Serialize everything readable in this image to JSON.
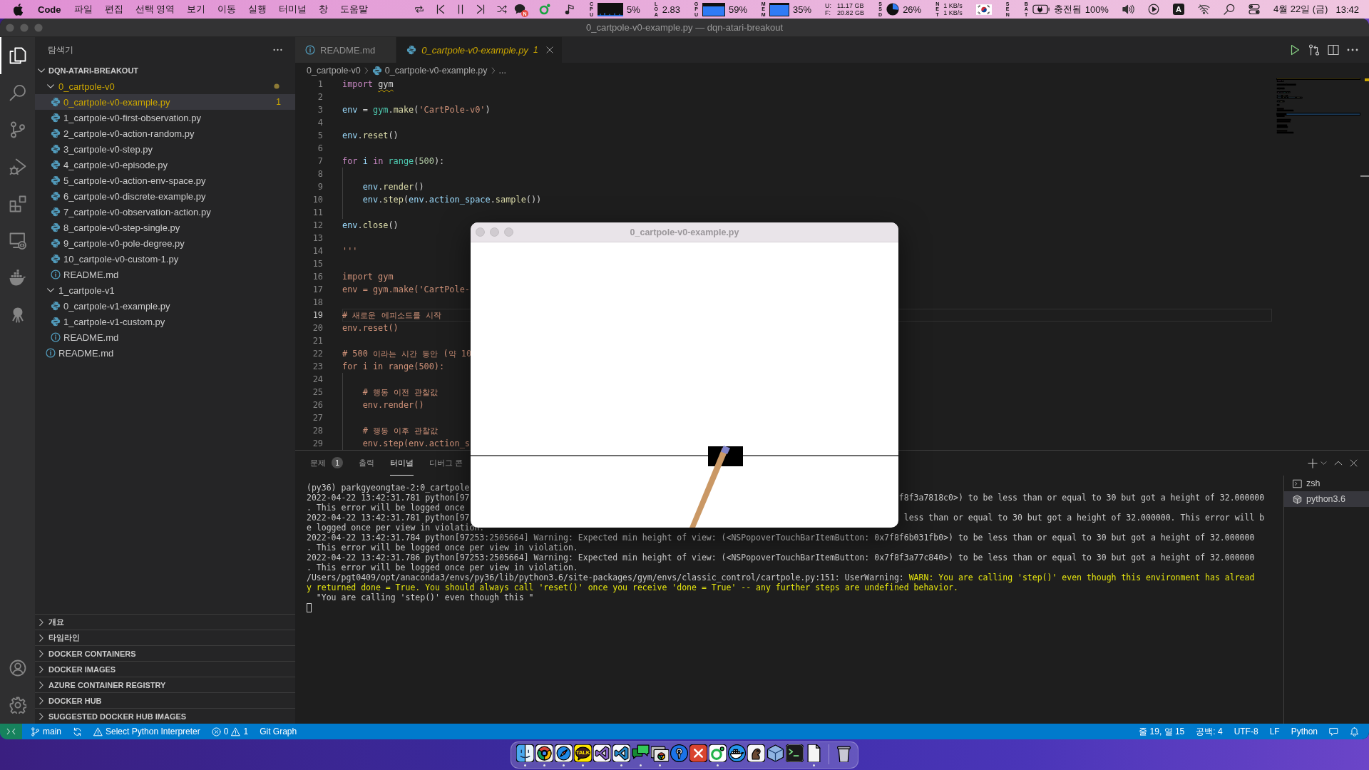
{
  "menu_bar": {
    "app_name": "Code",
    "menus": [
      "파일",
      "편집",
      "선택 영역",
      "보기",
      "이동",
      "실행",
      "터미널",
      "창",
      "도움말"
    ],
    "media_controls": [
      {
        "kind": "repeat"
      },
      {
        "kind": "previous"
      },
      {
        "kind": "pause"
      },
      {
        "kind": "next"
      },
      {
        "kind": "shuffle"
      }
    ],
    "status_items": [
      {
        "kind": "chat",
        "badge": "N"
      },
      {
        "kind": "ring"
      },
      {
        "kind": "note"
      },
      {
        "kind": "cpu",
        "label": "CPU",
        "value": "5%"
      },
      {
        "kind": "load",
        "label": "LOA",
        "value": "2.83"
      },
      {
        "kind": "gpu",
        "label": "GPU",
        "value": "59%"
      },
      {
        "kind": "mem",
        "label": "MEM",
        "value": "35%"
      },
      {
        "kind": "disk",
        "rows": [
          {
            "label": "U:",
            "value": "11.17 GB"
          },
          {
            "label": "F:",
            "value": "20.82 GB"
          }
        ]
      },
      {
        "kind": "ssd",
        "label": "SSD",
        "value": "26%"
      },
      {
        "kind": "net",
        "label": "NET",
        "rates": [
          "1 KB/s",
          "1 KB/s"
        ]
      },
      {
        "kind": "flag"
      },
      {
        "kind": "sensor",
        "label": "SEN"
      },
      {
        "kind": "battery",
        "label": "BAT",
        "state": "충전됨",
        "value": "100%"
      },
      {
        "kind": "volume"
      },
      {
        "kind": "play"
      },
      {
        "kind": "input",
        "label": "A"
      },
      {
        "kind": "wifi"
      },
      {
        "kind": "search"
      },
      {
        "kind": "control"
      },
      {
        "kind": "clock",
        "date": "4월 22일 (금)",
        "time": "13:42"
      }
    ]
  },
  "window": {
    "title": "0_cartpole-v0-example.py — dqn-atari-breakout"
  },
  "activity_bar": {
    "items": [
      {
        "kind": "explorer",
        "selected": true
      },
      {
        "kind": "search",
        "selected": false
      },
      {
        "kind": "scm",
        "selected": false
      },
      {
        "kind": "debug",
        "selected": false
      },
      {
        "kind": "extensions",
        "selected": false
      },
      {
        "kind": "remote",
        "selected": false
      },
      {
        "kind": "docker",
        "selected": false
      },
      {
        "kind": "octopus",
        "selected": false
      }
    ],
    "bottom": [
      {
        "kind": "account"
      },
      {
        "kind": "settings"
      }
    ]
  },
  "sidebar": {
    "title": "탐색기",
    "root": {
      "label": "DQN-ATARI-BREAKOUT",
      "expanded": true
    },
    "tree": [
      {
        "kind": "folder",
        "label": "0_cartpole-v0",
        "expanded": true,
        "selected": false,
        "warning": true,
        "children": [
          {
            "kind": "python",
            "label": "0_cartpole-v0-example.py",
            "badge": "1",
            "selected": true,
            "warning": true
          },
          {
            "kind": "python",
            "label": "1_cartpole-v0-first-observation.py",
            "selected": false,
            "warning": false
          },
          {
            "kind": "python",
            "label": "2_cartpole-v0-action-random.py",
            "selected": false,
            "warning": false
          },
          {
            "kind": "python",
            "label": "3_cartpole-v0-step.py",
            "selected": false,
            "warning": false
          },
          {
            "kind": "python",
            "label": "4_cartpole-v0-episode.py",
            "selected": false,
            "warning": false
          },
          {
            "kind": "python",
            "label": "5_cartpole-v0-action-env-space.py",
            "selected": false,
            "warning": false
          },
          {
            "kind": "python",
            "label": "6_cartpole-v0-discrete-example.py",
            "selected": false,
            "warning": false
          },
          {
            "kind": "python",
            "label": "7_cartpole-v0-observation-action.py",
            "selected": false,
            "warning": false
          },
          {
            "kind": "python",
            "label": "8_cartpole-v0-step-single.py",
            "selected": false,
            "warning": false
          },
          {
            "kind": "python",
            "label": "9_cartpole-v0-pole-degree.py",
            "selected": false,
            "warning": false
          },
          {
            "kind": "python",
            "label": "10_cartpole-v0-custom-1.py",
            "selected": false,
            "warning": false
          },
          {
            "kind": "markdown",
            "label": "README.md",
            "selected": false,
            "warning": false
          }
        ]
      },
      {
        "kind": "folder",
        "label": "1_cartpole-v1",
        "expanded": true,
        "selected": false,
        "warning": false,
        "children": [
          {
            "kind": "python",
            "label": "0_cartpole-v1-example.py",
            "selected": false,
            "warning": false
          },
          {
            "kind": "python",
            "label": "1_cartpole-v1-custom.py",
            "selected": false,
            "warning": false
          },
          {
            "kind": "markdown",
            "label": "README.md",
            "selected": false,
            "warning": false
          }
        ]
      },
      {
        "kind": "markdown",
        "label": "README.md",
        "selected": false,
        "warning": false
      }
    ],
    "sections": [
      {
        "label": "개요",
        "expanded": false
      },
      {
        "label": "타임라인",
        "expanded": false
      },
      {
        "label": "DOCKER CONTAINERS",
        "expanded": false
      },
      {
        "label": "DOCKER IMAGES",
        "expanded": false
      },
      {
        "label": "AZURE CONTAINER REGISTRY",
        "expanded": false
      },
      {
        "label": "DOCKER HUB",
        "expanded": false
      },
      {
        "label": "SUGGESTED DOCKER HUB IMAGES",
        "expanded": false
      }
    ]
  },
  "editor": {
    "tabs": [
      {
        "kind": "markdown",
        "label": "README.md",
        "selected": false,
        "preview": false,
        "warning": false
      },
      {
        "kind": "python",
        "label": "0_cartpole-v0-example.py",
        "badge": "1",
        "selected": true,
        "preview": true,
        "warning": true
      }
    ],
    "actions": [
      {
        "kind": "run"
      },
      {
        "kind": "compare"
      },
      {
        "kind": "split"
      },
      {
        "kind": "more"
      }
    ],
    "breadcrumb": [
      {
        "kind": "folder",
        "label": "0_cartpole-v0"
      },
      {
        "kind": "python",
        "label": "0_cartpole-v0-example.py"
      },
      {
        "kind": "symbol",
        "label": "..."
      }
    ],
    "lines": [
      {
        "number": "1",
        "current": false,
        "tokens": [
          {
            "kind": "keyword",
            "text": "import "
          },
          {
            "kind": "unresolved",
            "text": "gym"
          }
        ]
      },
      {
        "number": "2",
        "current": false
      },
      {
        "number": "3",
        "current": false,
        "tokens": [
          {
            "kind": "variable",
            "text": "env"
          },
          {
            "kind": "plain",
            "text": " = "
          },
          {
            "kind": "module",
            "text": "gym"
          },
          {
            "kind": "plain",
            "text": "."
          },
          {
            "kind": "function",
            "text": "make"
          },
          {
            "kind": "plain",
            "text": "("
          },
          {
            "kind": "string",
            "text": "'CartPole-v0'"
          },
          {
            "kind": "plain",
            "text": ")"
          }
        ]
      },
      {
        "number": "4",
        "current": false
      },
      {
        "number": "5",
        "current": false,
        "tokens": [
          {
            "kind": "variable",
            "text": "env"
          },
          {
            "kind": "plain",
            "text": "."
          },
          {
            "kind": "function",
            "text": "reset"
          },
          {
            "kind": "plain",
            "text": "()"
          }
        ]
      },
      {
        "number": "6",
        "current": false
      },
      {
        "number": "7",
        "current": false,
        "tokens": [
          {
            "kind": "keyword",
            "text": "for "
          },
          {
            "kind": "variable",
            "text": "i "
          },
          {
            "kind": "keyword",
            "text": "in "
          },
          {
            "kind": "builtin",
            "text": "range"
          },
          {
            "kind": "plain",
            "text": "("
          },
          {
            "kind": "number",
            "text": "500"
          },
          {
            "kind": "plain",
            "text": "):"
          }
        ]
      },
      {
        "number": "8",
        "current": false
      },
      {
        "number": "9",
        "current": false,
        "tokens": [
          {
            "kind": "variable",
            "text": "    env"
          },
          {
            "kind": "plain",
            "text": "."
          },
          {
            "kind": "function",
            "text": "render"
          },
          {
            "kind": "plain",
            "text": "()"
          }
        ]
      },
      {
        "number": "10",
        "current": false,
        "tokens": [
          {
            "kind": "variable",
            "text": "    env"
          },
          {
            "kind": "plain",
            "text": "."
          },
          {
            "kind": "function",
            "text": "step"
          },
          {
            "kind": "plain",
            "text": "("
          },
          {
            "kind": "variable",
            "text": "env"
          },
          {
            "kind": "plain",
            "text": "."
          },
          {
            "kind": "variable",
            "text": "action_space"
          },
          {
            "kind": "plain",
            "text": "."
          },
          {
            "kind": "function",
            "text": "sample"
          },
          {
            "kind": "plain",
            "text": "())"
          }
        ]
      },
      {
        "number": "11",
        "current": false
      },
      {
        "number": "12",
        "current": false,
        "tokens": [
          {
            "kind": "variable",
            "text": "env"
          },
          {
            "kind": "plain",
            "text": "."
          },
          {
            "kind": "function",
            "text": "close"
          },
          {
            "kind": "plain",
            "text": "()"
          }
        ]
      },
      {
        "number": "13",
        "current": false
      },
      {
        "number": "14",
        "current": false,
        "tokens": [
          {
            "kind": "string",
            "text": "'''"
          }
        ]
      },
      {
        "number": "15",
        "current": false
      },
      {
        "number": "16",
        "current": false,
        "tokens": [
          {
            "kind": "string",
            "text": "import gym"
          }
        ]
      },
      {
        "number": "17",
        "current": false,
        "tokens": [
          {
            "kind": "string",
            "text": "env = gym.make('CartPole-"
          }
        ]
      },
      {
        "number": "18",
        "current": false
      },
      {
        "number": "19",
        "current": true,
        "tokens": [
          {
            "kind": "string",
            "text": "# 새로운 에피소드를 시작"
          }
        ]
      },
      {
        "number": "20",
        "current": false,
        "tokens": [
          {
            "kind": "string",
            "text": "env.reset()"
          }
        ]
      },
      {
        "number": "21",
        "current": false
      },
      {
        "number": "22",
        "current": false,
        "tokens": [
          {
            "kind": "string",
            "text": "# 500 이라는 시간 동안 (약 10"
          }
        ]
      },
      {
        "number": "23",
        "current": false,
        "tokens": [
          {
            "kind": "string",
            "text": "for i in range(500):"
          }
        ]
      },
      {
        "number": "24",
        "current": false
      },
      {
        "number": "25",
        "current": false,
        "tokens": [
          {
            "kind": "string",
            "text": "    # 행동 이전 관찰값"
          }
        ]
      },
      {
        "number": "26",
        "current": false,
        "tokens": [
          {
            "kind": "string",
            "text": "    env.render()"
          }
        ]
      },
      {
        "number": "27",
        "current": false
      },
      {
        "number": "28",
        "current": false,
        "tokens": [
          {
            "kind": "string",
            "text": "    # 행동 이후 관찰값"
          }
        ]
      },
      {
        "number": "29",
        "current": false,
        "tokens": [
          {
            "kind": "string",
            "text": "    env.step(env.action_s"
          }
        ]
      }
    ]
  },
  "panel": {
    "tabs": [
      {
        "label": "문제",
        "badge": "1",
        "selected": false
      },
      {
        "label": "출력",
        "selected": false
      },
      {
        "label": "터미널",
        "selected": true
      },
      {
        "label": "디버그 콘",
        "selected": false
      }
    ],
    "actions": [
      {
        "kind": "add"
      },
      {
        "kind": "dropdown"
      },
      {
        "kind": "maximize"
      },
      {
        "kind": "close"
      }
    ],
    "terminal_lines": [
      [
        {
          "kind": "plain",
          "text": "(py36) parkgyeongtae-2:0_cartpole"
        }
      ],
      [
        {
          "kind": "plain",
          "text": "2022-04-22 13:42:31.781 python[97"
        },
        {
          "kind": "tail",
          "text": "f8f3a7818c0>) to be less than or equal to 30 but got a height of 32.000000"
        }
      ],
      [
        {
          "kind": "plain",
          "text": ". This error will be logged once"
        }
      ],
      [
        {
          "kind": "plain",
          "text": "2022-04-22 13:42:31.781 python[97"
        },
        {
          "kind": "tail",
          "text": "less than or equal to 30 but got a height of 32.000000. This error will b"
        }
      ],
      [
        {
          "kind": "plain",
          "text": "e logged once per view in violation."
        }
      ],
      [
        {
          "kind": "plain",
          "text": "2022-04-22 13:42:31.784 python[97253:2505664] Warning: Expected min height of view: (<NSPopoverTouchBarItemButton: 0x7f8f6b031fb0>) to be less than or equal to 30 but got a height of 32.000000"
        }
      ],
      [
        {
          "kind": "plain",
          "text": ". This error will be logged once per view in violation."
        }
      ],
      [
        {
          "kind": "plain",
          "text": "2022-04-22 13:42:31.786 python[97253:2505664] Warning: Expected min height of view: (<NSPopoverTouchBarItemButton: 0x7f8f3a77c840>) to be less than or equal to 30 but got a height of 32.000000"
        }
      ],
      [
        {
          "kind": "plain",
          "text": ". This error will be logged once per view in violation."
        }
      ],
      [
        {
          "kind": "plain",
          "text": "/Users/pgt0409/opt/anaconda3/envs/py36/lib/python3.6/site-packages/gym/envs/classic_control/cartpole.py:151: UserWarning: "
        },
        {
          "kind": "warn",
          "text": "WARN: You are calling 'step()' even though this environment has alread"
        }
      ],
      [
        {
          "kind": "warn",
          "text": "y returned done = True. You should always call 'reset()' once you receive 'done = True' -- any further steps are undefined behavior."
        }
      ],
      [
        {
          "kind": "plain",
          "text": "  \"You are calling 'step()' even though this \""
        }
      ]
    ],
    "cursor": true,
    "terminals": [
      {
        "kind": "shell",
        "label": "zsh",
        "selected": false
      },
      {
        "kind": "python",
        "label": "python3.6",
        "selected": true
      }
    ]
  },
  "status_bar": {
    "left": [
      {
        "kind": "remote"
      },
      {
        "kind": "branch",
        "label": "main"
      },
      {
        "kind": "sync"
      },
      {
        "kind": "interpreter",
        "label": "Select Python Interpreter"
      },
      {
        "kind": "problems",
        "errors": "0",
        "warnings": "1"
      },
      {
        "kind": "text",
        "label": "Git Graph"
      }
    ],
    "right": [
      {
        "kind": "text",
        "label": "줄 19, 열 15"
      },
      {
        "kind": "text",
        "label": "공백: 4"
      },
      {
        "kind": "text",
        "label": "UTF-8"
      },
      {
        "kind": "text",
        "label": "LF"
      },
      {
        "kind": "text",
        "label": "Python"
      },
      {
        "kind": "feedback"
      },
      {
        "kind": "bell"
      }
    ]
  },
  "popup_window": {
    "title": "0_cartpole-v0-example.py"
  },
  "dock": {
    "apps": [
      {
        "kind": "face-tile",
        "running": true
      },
      {
        "kind": "color-wheel",
        "running": true
      },
      {
        "kind": "compass",
        "running": true
      },
      {
        "kind": "speech-bubble",
        "label": "TALK",
        "running": true
      },
      {
        "kind": "ribbon-purple",
        "running": false
      },
      {
        "kind": "ribbon-blue",
        "running": true
      },
      {
        "kind": "chat-bubbles",
        "running": true
      },
      {
        "kind": "window-stack",
        "running": true
      },
      {
        "kind": "map-pin",
        "running": false
      },
      {
        "kind": "cross-tile",
        "running": false
      },
      {
        "kind": "ring",
        "running": true
      },
      {
        "kind": "whale",
        "running": false
      },
      {
        "kind": "blob-tile",
        "running": false
      },
      {
        "kind": "cube",
        "running": false
      },
      {
        "kind": "terminal",
        "running": false
      },
      {
        "kind": "document",
        "running": true
      }
    ],
    "trailing": [
      {
        "kind": "trash",
        "running": false
      }
    ]
  }
}
